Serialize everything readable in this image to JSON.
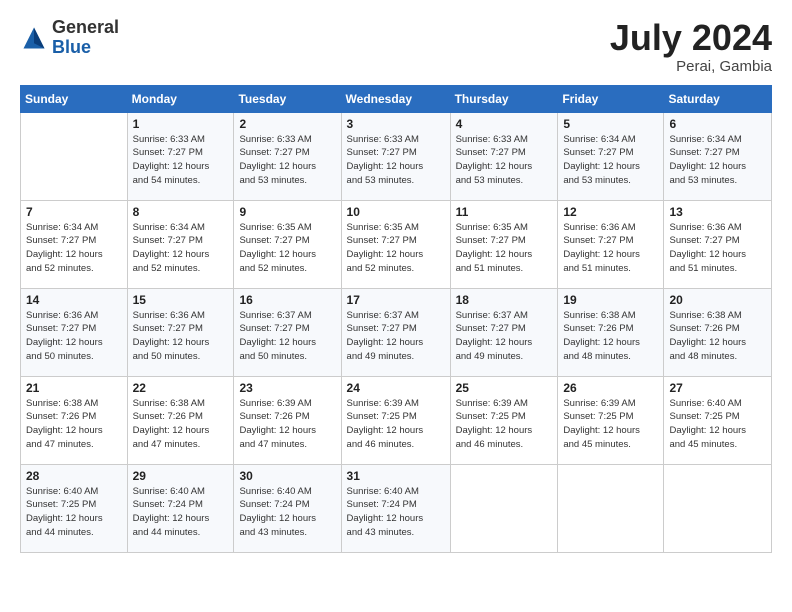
{
  "header": {
    "logo_general": "General",
    "logo_blue": "Blue",
    "month_title": "July 2024",
    "subtitle": "Perai, Gambia"
  },
  "days_of_week": [
    "Sunday",
    "Monday",
    "Tuesday",
    "Wednesday",
    "Thursday",
    "Friday",
    "Saturday"
  ],
  "weeks": [
    [
      {
        "day": "",
        "info": ""
      },
      {
        "day": "1",
        "info": "Sunrise: 6:33 AM\nSunset: 7:27 PM\nDaylight: 12 hours\nand 54 minutes."
      },
      {
        "day": "2",
        "info": "Sunrise: 6:33 AM\nSunset: 7:27 PM\nDaylight: 12 hours\nand 53 minutes."
      },
      {
        "day": "3",
        "info": "Sunrise: 6:33 AM\nSunset: 7:27 PM\nDaylight: 12 hours\nand 53 minutes."
      },
      {
        "day": "4",
        "info": "Sunrise: 6:33 AM\nSunset: 7:27 PM\nDaylight: 12 hours\nand 53 minutes."
      },
      {
        "day": "5",
        "info": "Sunrise: 6:34 AM\nSunset: 7:27 PM\nDaylight: 12 hours\nand 53 minutes."
      },
      {
        "day": "6",
        "info": "Sunrise: 6:34 AM\nSunset: 7:27 PM\nDaylight: 12 hours\nand 53 minutes."
      }
    ],
    [
      {
        "day": "7",
        "info": "Sunrise: 6:34 AM\nSunset: 7:27 PM\nDaylight: 12 hours\nand 52 minutes."
      },
      {
        "day": "8",
        "info": "Sunrise: 6:34 AM\nSunset: 7:27 PM\nDaylight: 12 hours\nand 52 minutes."
      },
      {
        "day": "9",
        "info": "Sunrise: 6:35 AM\nSunset: 7:27 PM\nDaylight: 12 hours\nand 52 minutes."
      },
      {
        "day": "10",
        "info": "Sunrise: 6:35 AM\nSunset: 7:27 PM\nDaylight: 12 hours\nand 52 minutes."
      },
      {
        "day": "11",
        "info": "Sunrise: 6:35 AM\nSunset: 7:27 PM\nDaylight: 12 hours\nand 51 minutes."
      },
      {
        "day": "12",
        "info": "Sunrise: 6:36 AM\nSunset: 7:27 PM\nDaylight: 12 hours\nand 51 minutes."
      },
      {
        "day": "13",
        "info": "Sunrise: 6:36 AM\nSunset: 7:27 PM\nDaylight: 12 hours\nand 51 minutes."
      }
    ],
    [
      {
        "day": "14",
        "info": "Sunrise: 6:36 AM\nSunset: 7:27 PM\nDaylight: 12 hours\nand 50 minutes."
      },
      {
        "day": "15",
        "info": "Sunrise: 6:36 AM\nSunset: 7:27 PM\nDaylight: 12 hours\nand 50 minutes."
      },
      {
        "day": "16",
        "info": "Sunrise: 6:37 AM\nSunset: 7:27 PM\nDaylight: 12 hours\nand 50 minutes."
      },
      {
        "day": "17",
        "info": "Sunrise: 6:37 AM\nSunset: 7:27 PM\nDaylight: 12 hours\nand 49 minutes."
      },
      {
        "day": "18",
        "info": "Sunrise: 6:37 AM\nSunset: 7:27 PM\nDaylight: 12 hours\nand 49 minutes."
      },
      {
        "day": "19",
        "info": "Sunrise: 6:38 AM\nSunset: 7:26 PM\nDaylight: 12 hours\nand 48 minutes."
      },
      {
        "day": "20",
        "info": "Sunrise: 6:38 AM\nSunset: 7:26 PM\nDaylight: 12 hours\nand 48 minutes."
      }
    ],
    [
      {
        "day": "21",
        "info": "Sunrise: 6:38 AM\nSunset: 7:26 PM\nDaylight: 12 hours\nand 47 minutes."
      },
      {
        "day": "22",
        "info": "Sunrise: 6:38 AM\nSunset: 7:26 PM\nDaylight: 12 hours\nand 47 minutes."
      },
      {
        "day": "23",
        "info": "Sunrise: 6:39 AM\nSunset: 7:26 PM\nDaylight: 12 hours\nand 47 minutes."
      },
      {
        "day": "24",
        "info": "Sunrise: 6:39 AM\nSunset: 7:25 PM\nDaylight: 12 hours\nand 46 minutes."
      },
      {
        "day": "25",
        "info": "Sunrise: 6:39 AM\nSunset: 7:25 PM\nDaylight: 12 hours\nand 46 minutes."
      },
      {
        "day": "26",
        "info": "Sunrise: 6:39 AM\nSunset: 7:25 PM\nDaylight: 12 hours\nand 45 minutes."
      },
      {
        "day": "27",
        "info": "Sunrise: 6:40 AM\nSunset: 7:25 PM\nDaylight: 12 hours\nand 45 minutes."
      }
    ],
    [
      {
        "day": "28",
        "info": "Sunrise: 6:40 AM\nSunset: 7:25 PM\nDaylight: 12 hours\nand 44 minutes."
      },
      {
        "day": "29",
        "info": "Sunrise: 6:40 AM\nSunset: 7:24 PM\nDaylight: 12 hours\nand 44 minutes."
      },
      {
        "day": "30",
        "info": "Sunrise: 6:40 AM\nSunset: 7:24 PM\nDaylight: 12 hours\nand 43 minutes."
      },
      {
        "day": "31",
        "info": "Sunrise: 6:40 AM\nSunset: 7:24 PM\nDaylight: 12 hours\nand 43 minutes."
      },
      {
        "day": "",
        "info": ""
      },
      {
        "day": "",
        "info": ""
      },
      {
        "day": "",
        "info": ""
      }
    ]
  ]
}
